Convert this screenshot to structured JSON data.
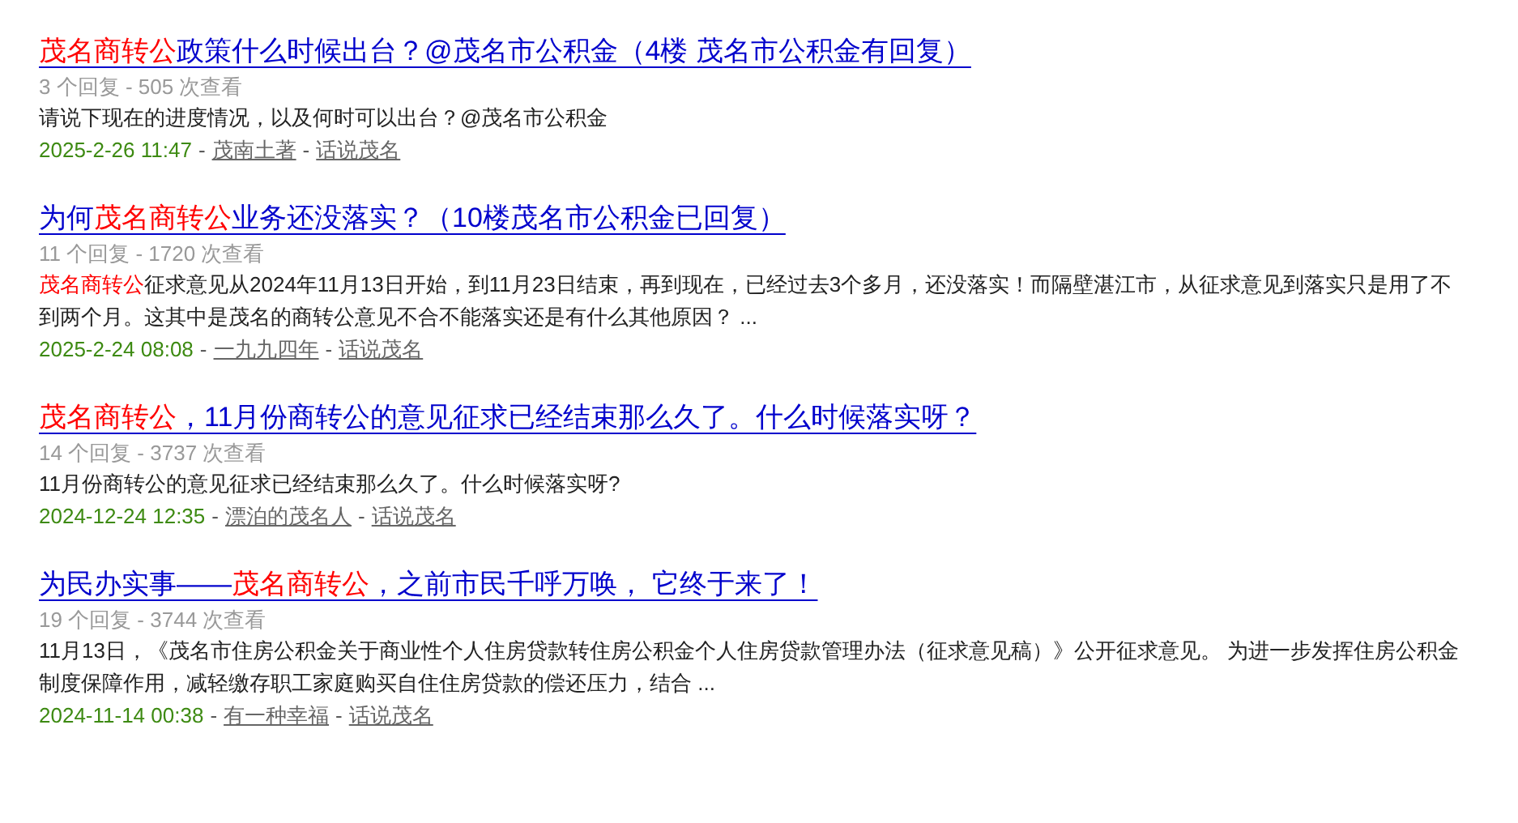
{
  "results": [
    {
      "title": [
        {
          "text": "茂名商转公",
          "highlight": true
        },
        {
          "text": "政策什么时候出台？@茂名市公积金（4楼 茂名市公积金有回复）",
          "highlight": false
        }
      ],
      "stats": "3 个回复 - 505 次查看",
      "excerpt": [
        {
          "text": "请说下现在的进度情况，以及何时可以出台？@茂名市公积金",
          "highlight": false
        }
      ],
      "date": "2025-2-26 11:47",
      "sep1": "-",
      "sep2": "-",
      "author": "茂南土著",
      "forum": "话说茂名"
    },
    {
      "title": [
        {
          "text": "为何",
          "highlight": false
        },
        {
          "text": "茂名商转公",
          "highlight": true
        },
        {
          "text": "业务还没落实？（10楼茂名市公积金已回复）",
          "highlight": false
        }
      ],
      "stats": "11 个回复 - 1720 次查看",
      "excerpt": [
        {
          "text": "茂名商转公",
          "highlight": true
        },
        {
          "text": "征求意见从2024年11月13日开始，到11月23日结束，再到现在，已经过去3个多月，还没落实！而隔壁湛江市，从征求意见到落实只是用了不到两个月。这其中是茂名的商转公意见不合不能落实还是有什么其他原因？ ...",
          "highlight": false
        }
      ],
      "date": "2025-2-24 08:08",
      "sep1": "-",
      "sep2": "-",
      "author": "一九九四年",
      "forum": "话说茂名"
    },
    {
      "title": [
        {
          "text": "茂名商转公",
          "highlight": true
        },
        {
          "text": "，11月份商转公的意见征求已经结束那么久了。什么时候落实呀？",
          "highlight": false
        }
      ],
      "stats": "14 个回复 - 3737 次查看",
      "excerpt": [
        {
          "text": "11月份商转公的意见征求已经结束那么久了。什么时候落实呀?",
          "highlight": false
        }
      ],
      "date": "2024-12-24 12:35",
      "sep1": "-",
      "sep2": "-",
      "author": "漂泊的茂名人",
      "forum": "话说茂名"
    },
    {
      "title": [
        {
          "text": "为民办实事——",
          "highlight": false
        },
        {
          "text": "茂名商转公",
          "highlight": true
        },
        {
          "text": "，之前市民千呼万唤， 它终于来了！",
          "highlight": false
        }
      ],
      "stats": "19 个回复 - 3744 次查看",
      "excerpt": [
        {
          "text": "11月13日，《茂名市住房公积金关于商业性个人住房贷款转住房公积金个人住房贷款管理办法（征求意见稿）》公开征求意见。 为进一步发挥住房公积金制度保障作用，减轻缴存职工家庭购买自住住房贷款的偿还压力，结合 ...",
          "highlight": false
        }
      ],
      "date": "2024-11-14 00:38",
      "sep1": "-",
      "sep2": "-",
      "author": "有一种幸福",
      "forum": "话说茂名"
    }
  ]
}
